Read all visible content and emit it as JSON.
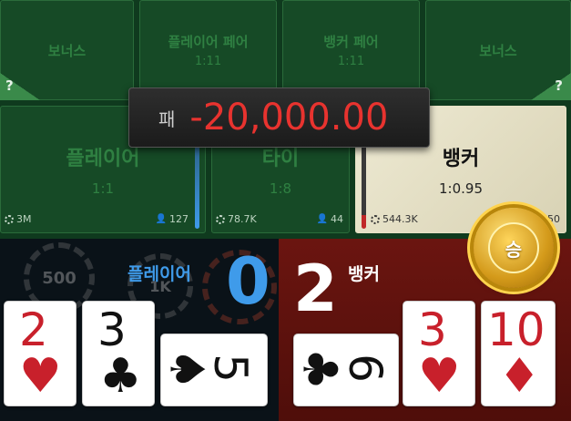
{
  "table": {
    "top_row": [
      {
        "name": "보너스",
        "odds": "",
        "help": "?"
      },
      {
        "name": "플레이어 페어",
        "odds": "1:11"
      },
      {
        "name": "뱅커 페어",
        "odds": "1:11"
      },
      {
        "name": "보너스",
        "odds": "",
        "help": "?"
      }
    ],
    "player": {
      "name": "플레이어",
      "odds": "1:1",
      "total_bet": "3M",
      "players": "127"
    },
    "tie": {
      "name": "타이",
      "odds": "1:8",
      "total_bet": "78.7K",
      "players": "44"
    },
    "banker": {
      "name": "뱅커",
      "odds": "1:0.95",
      "total_bet": "544.3K",
      "players": "50"
    }
  },
  "result_popup": {
    "label": "패",
    "amount": "-20,000.00"
  },
  "player_hand": {
    "label": "플레이어",
    "score": "0",
    "bg_chip_values": [
      "500",
      "1K"
    ],
    "cards": [
      {
        "rank": "2",
        "suit": "♥",
        "color": "red"
      },
      {
        "rank": "3",
        "suit": "♣",
        "color": "black"
      },
      {
        "rank": "5",
        "suit": "♠",
        "color": "black"
      }
    ]
  },
  "banker_hand": {
    "label": "뱅커",
    "score": "2",
    "cards": [
      {
        "rank": "6",
        "suit": "♣",
        "color": "black"
      },
      {
        "rank": "3",
        "suit": "♥",
        "color": "red"
      },
      {
        "rank": "10",
        "suit": "♦",
        "color": "red"
      }
    ]
  },
  "win_badge": {
    "label": "승",
    "icon": "gold-medal-icon"
  },
  "colors": {
    "player_blue": "#3f9bea",
    "loss_red": "#e8332f",
    "felt_green": "#164a26",
    "banker_red": "#6b1510"
  }
}
